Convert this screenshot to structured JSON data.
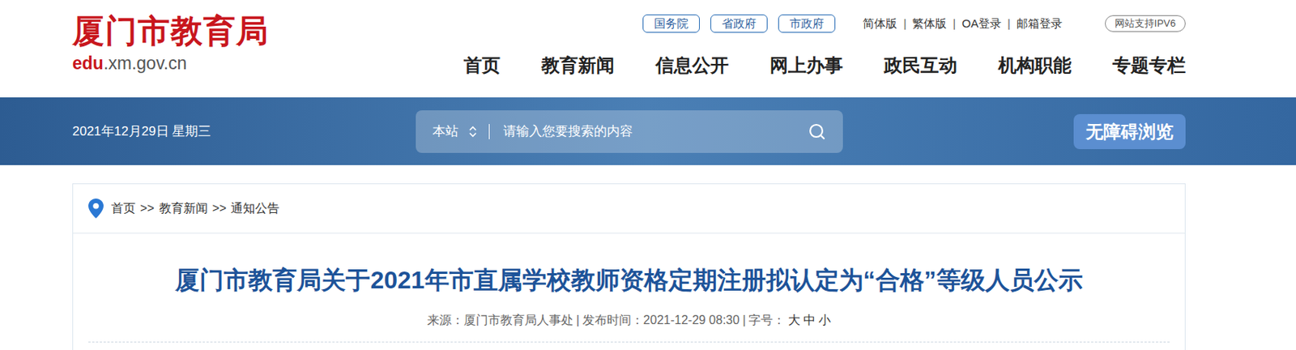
{
  "header": {
    "logo": {
      "title": "厦门市教育局",
      "domain_highlight": "edu",
      "domain_rest": ".xm.gov.cn"
    },
    "gov_links": [
      "国务院",
      "省政府",
      "市政府"
    ],
    "top_links": [
      "简体版",
      "繁体版",
      "OA登录",
      "邮箱登录"
    ],
    "top_separator": "|",
    "ipv6_badge": "网站支持IPV6",
    "nav": [
      {
        "label": "首页",
        "selected": false
      },
      {
        "label": "教育新闻",
        "selected": false
      },
      {
        "label": "信息公开",
        "selected": false
      },
      {
        "label": "网上办事",
        "selected": false
      },
      {
        "label": "政民互动",
        "selected": false
      },
      {
        "label": "机构职能",
        "selected": false
      },
      {
        "label": "专题专栏",
        "selected": false
      }
    ]
  },
  "banner": {
    "date": "2021年12月29日 星期三",
    "search": {
      "scope": "本站",
      "placeholder": "请输入您要搜索的内容"
    },
    "accessibility_button": "无障碍浏览"
  },
  "breadcrumb": {
    "items": [
      "首页",
      "教育新闻",
      "通知公告"
    ],
    "separator": ">>"
  },
  "article": {
    "title": "厦门市教育局关于2021年市直属学校教师资格定期注册拟认定为“合格”等级人员公示",
    "meta": {
      "source": "来源：厦门市教育局人事处",
      "published": "发布时间：2021-12-29 08:30",
      "separator": "|",
      "font_size_label": "字号：",
      "font_sizes": [
        "大",
        "中",
        "小"
      ]
    }
  }
}
